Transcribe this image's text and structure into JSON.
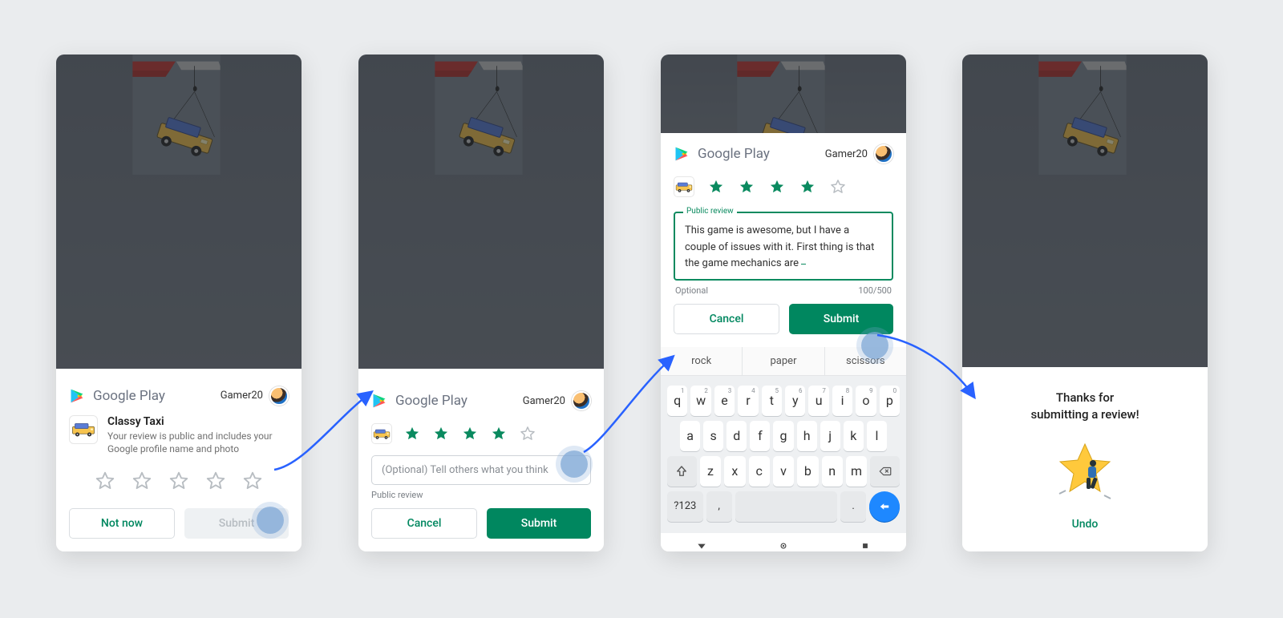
{
  "brand_text": "Google Play",
  "user": {
    "name": "Gamer20"
  },
  "step1": {
    "app_name": "Classy Taxi",
    "app_sub": "Your review is public and includes your Google profile name and photo",
    "not_now": "Not now",
    "submit": "Submit",
    "rating": 0
  },
  "step2": {
    "rating": 4,
    "placeholder": "(Optional) Tell others what you think",
    "field_hint": "Public review",
    "cancel": "Cancel",
    "submit": "Submit"
  },
  "step3": {
    "rating": 4,
    "legend": "Public review",
    "review_text": "This game is awesome, but I have a couple of issues with it. First thing is that the game mechanics are ",
    "optional": "Optional",
    "counter": "100/500",
    "cancel": "Cancel",
    "submit": "Submit",
    "suggestions": [
      "rock",
      "paper",
      "scissors"
    ],
    "kbd_rows": {
      "r1": [
        {
          "l": "q",
          "n": "1"
        },
        {
          "l": "w",
          "n": "2"
        },
        {
          "l": "e",
          "n": "3"
        },
        {
          "l": "r",
          "n": "4"
        },
        {
          "l": "t",
          "n": "5"
        },
        {
          "l": "y",
          "n": "6"
        },
        {
          "l": "u",
          "n": "7"
        },
        {
          "l": "i",
          "n": "8"
        },
        {
          "l": "o",
          "n": "9"
        },
        {
          "l": "p",
          "n": "0"
        }
      ],
      "r2": [
        "a",
        "s",
        "d",
        "f",
        "g",
        "h",
        "j",
        "k",
        "l"
      ],
      "r3": [
        "z",
        "x",
        "c",
        "v",
        "b",
        "n",
        "m"
      ],
      "sym": "?123",
      "comma": ",",
      "dot": "."
    }
  },
  "step4": {
    "thanks_line1": "Thanks for",
    "thanks_line2": "submitting a review!",
    "undo": "Undo"
  }
}
